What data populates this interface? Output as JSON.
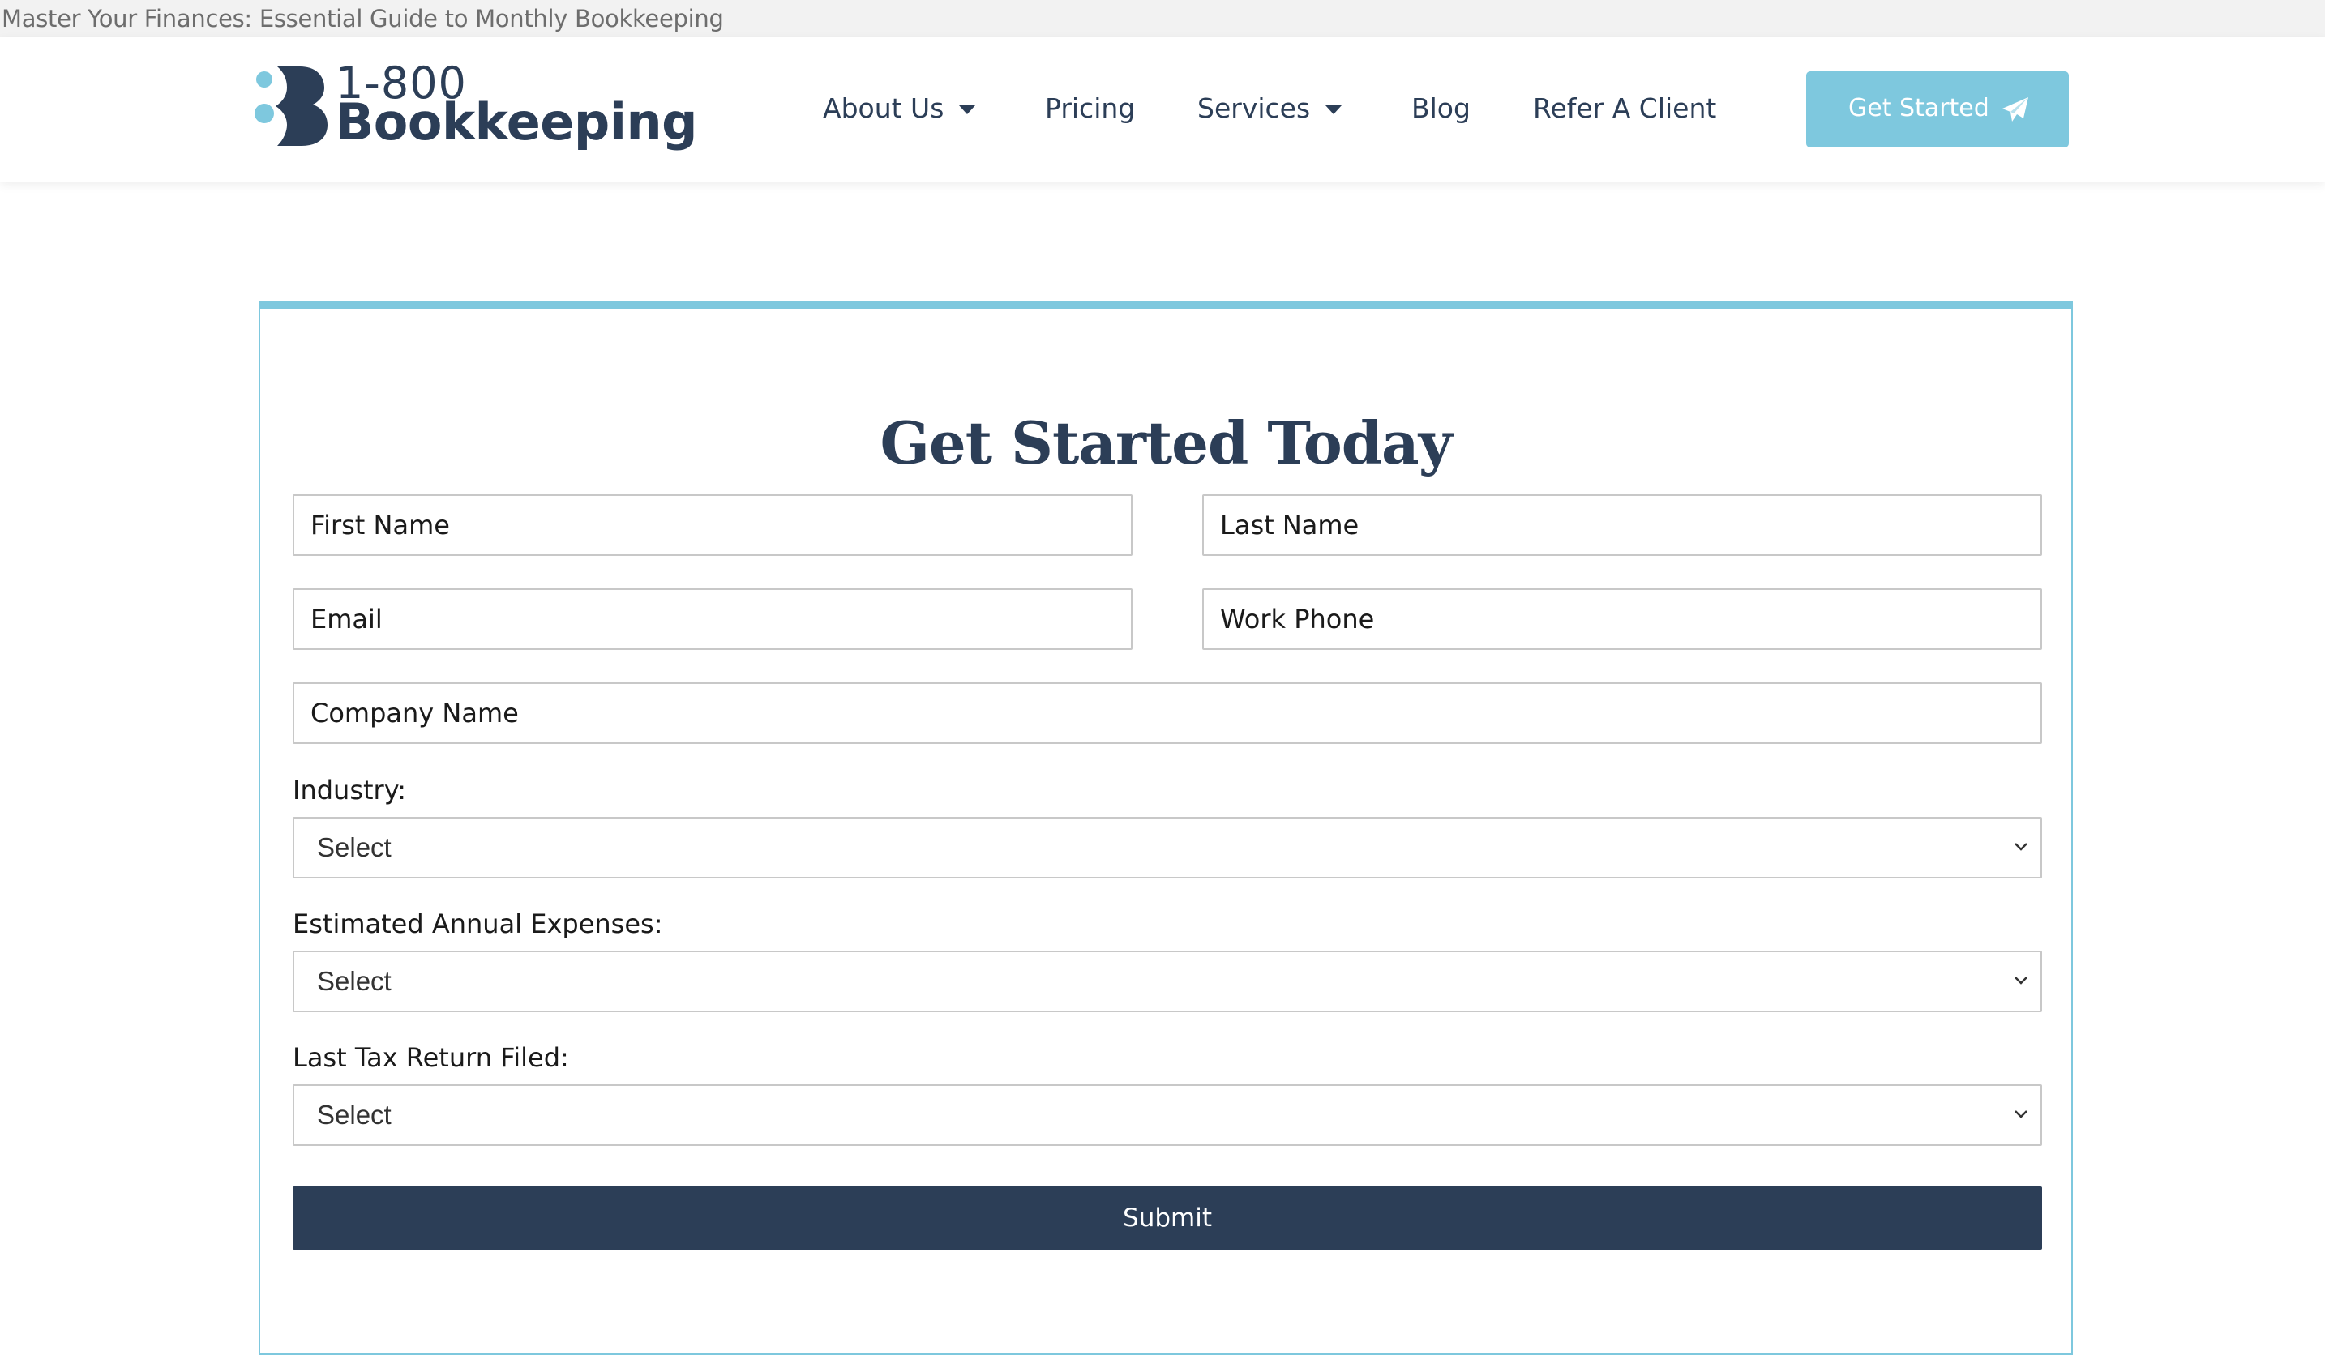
{
  "page": {
    "title": "Master Your Finances: Essential Guide to Monthly Bookkeeping"
  },
  "header": {
    "logo": {
      "number": "1-800",
      "word": "Bookkeeping",
      "icon": "bookkeeping-b-logo-icon"
    },
    "nav": [
      {
        "label": "About Us",
        "has_dropdown": true
      },
      {
        "label": "Pricing",
        "has_dropdown": false
      },
      {
        "label": "Services",
        "has_dropdown": true
      },
      {
        "label": "Blog",
        "has_dropdown": false
      },
      {
        "label": "Refer A Client",
        "has_dropdown": false
      }
    ],
    "cta": {
      "label": "Get Started",
      "icon": "paper-plane-icon"
    }
  },
  "form": {
    "heading": "Get Started Today",
    "first_name": {
      "placeholder": "First Name",
      "value": ""
    },
    "last_name": {
      "placeholder": "Last Name",
      "value": ""
    },
    "email": {
      "placeholder": "Email",
      "value": ""
    },
    "work_phone": {
      "placeholder": "Work Phone",
      "value": ""
    },
    "company_name": {
      "placeholder": "Company Name",
      "value": ""
    },
    "industry": {
      "label": "Industry:",
      "selected": "Select"
    },
    "expenses": {
      "label": "Estimated Annual Expenses:",
      "selected": "Select"
    },
    "tax_return": {
      "label": "Last Tax Return Filed:",
      "selected": "Select"
    },
    "submit_label": "Submit"
  },
  "colors": {
    "brand_navy": "#2c3e57",
    "accent_blue": "#7ec8de",
    "input_border": "#c8c8c8",
    "background": "#ffffff"
  }
}
